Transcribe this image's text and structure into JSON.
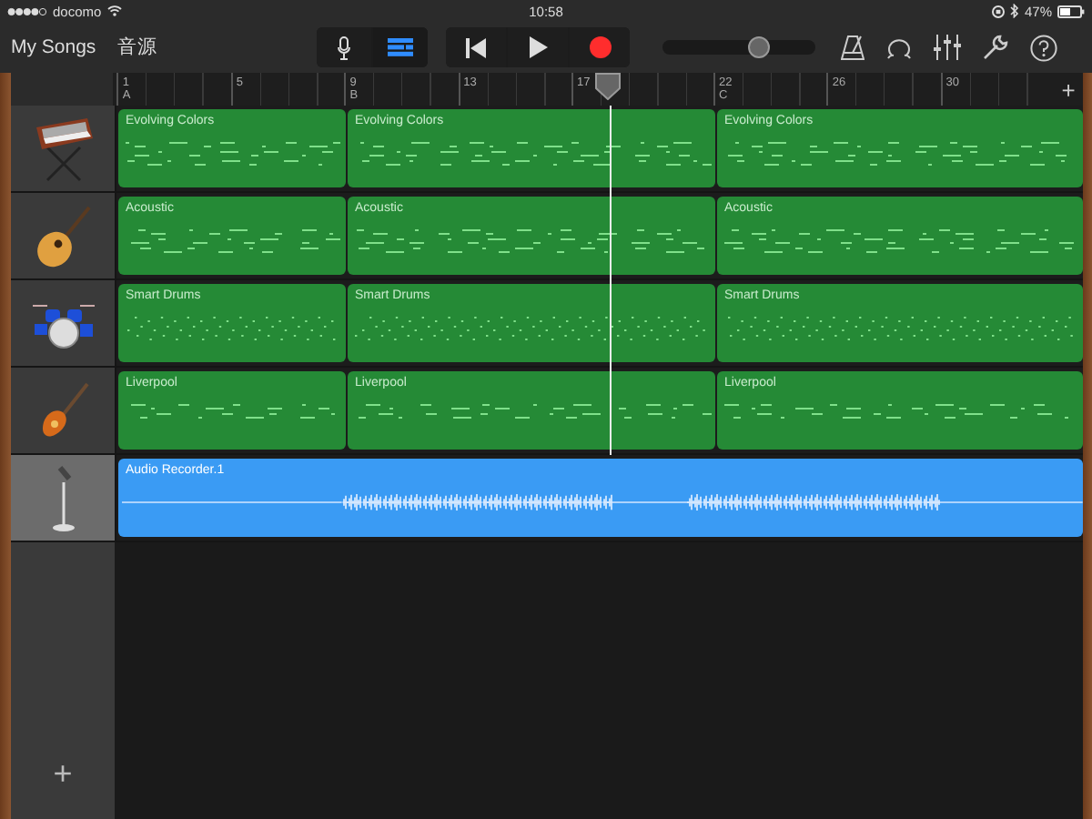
{
  "status_bar": {
    "carrier": "docomo",
    "time": "10:58",
    "battery": "47%"
  },
  "toolbar": {
    "my_songs": "My Songs",
    "sources": "音源",
    "views": [
      {
        "kind": "mic",
        "selected": false
      },
      {
        "kind": "tracks",
        "selected": true
      }
    ],
    "record_armed": true,
    "volume": {
      "level": 0.63
    }
  },
  "ruler": {
    "marks": [
      {
        "bar": "1",
        "section": "A"
      },
      {
        "bar": "5"
      },
      {
        "bar": "9",
        "section": "B"
      },
      {
        "bar": "13"
      },
      {
        "bar": "17"
      },
      {
        "bar": "22",
        "section": "C"
      },
      {
        "bar": "26"
      },
      {
        "bar": "30"
      }
    ],
    "add": "+"
  },
  "tracks": [
    {
      "kind": "synth",
      "selected": false,
      "regions": [
        {
          "name": "Evolving Colors"
        },
        {
          "name": "Evolving Colors"
        },
        {
          "name": "Evolving Colors"
        }
      ]
    },
    {
      "kind": "acoustic-guitar",
      "selected": false,
      "regions": [
        {
          "name": "Acoustic"
        },
        {
          "name": "Acoustic"
        },
        {
          "name": "Acoustic"
        }
      ]
    },
    {
      "kind": "drums",
      "selected": false,
      "regions": [
        {
          "name": "Smart Drums"
        },
        {
          "name": "Smart Drums"
        },
        {
          "name": "Smart Drums"
        }
      ]
    },
    {
      "kind": "electric-guitar",
      "selected": false,
      "regions": [
        {
          "name": "Liverpool"
        },
        {
          "name": "Liverpool"
        },
        {
          "name": "Liverpool"
        }
      ]
    },
    {
      "kind": "audio",
      "selected": true,
      "regions": [
        {
          "name": "Audio Recorder.1"
        }
      ]
    }
  ],
  "add_track": "+"
}
